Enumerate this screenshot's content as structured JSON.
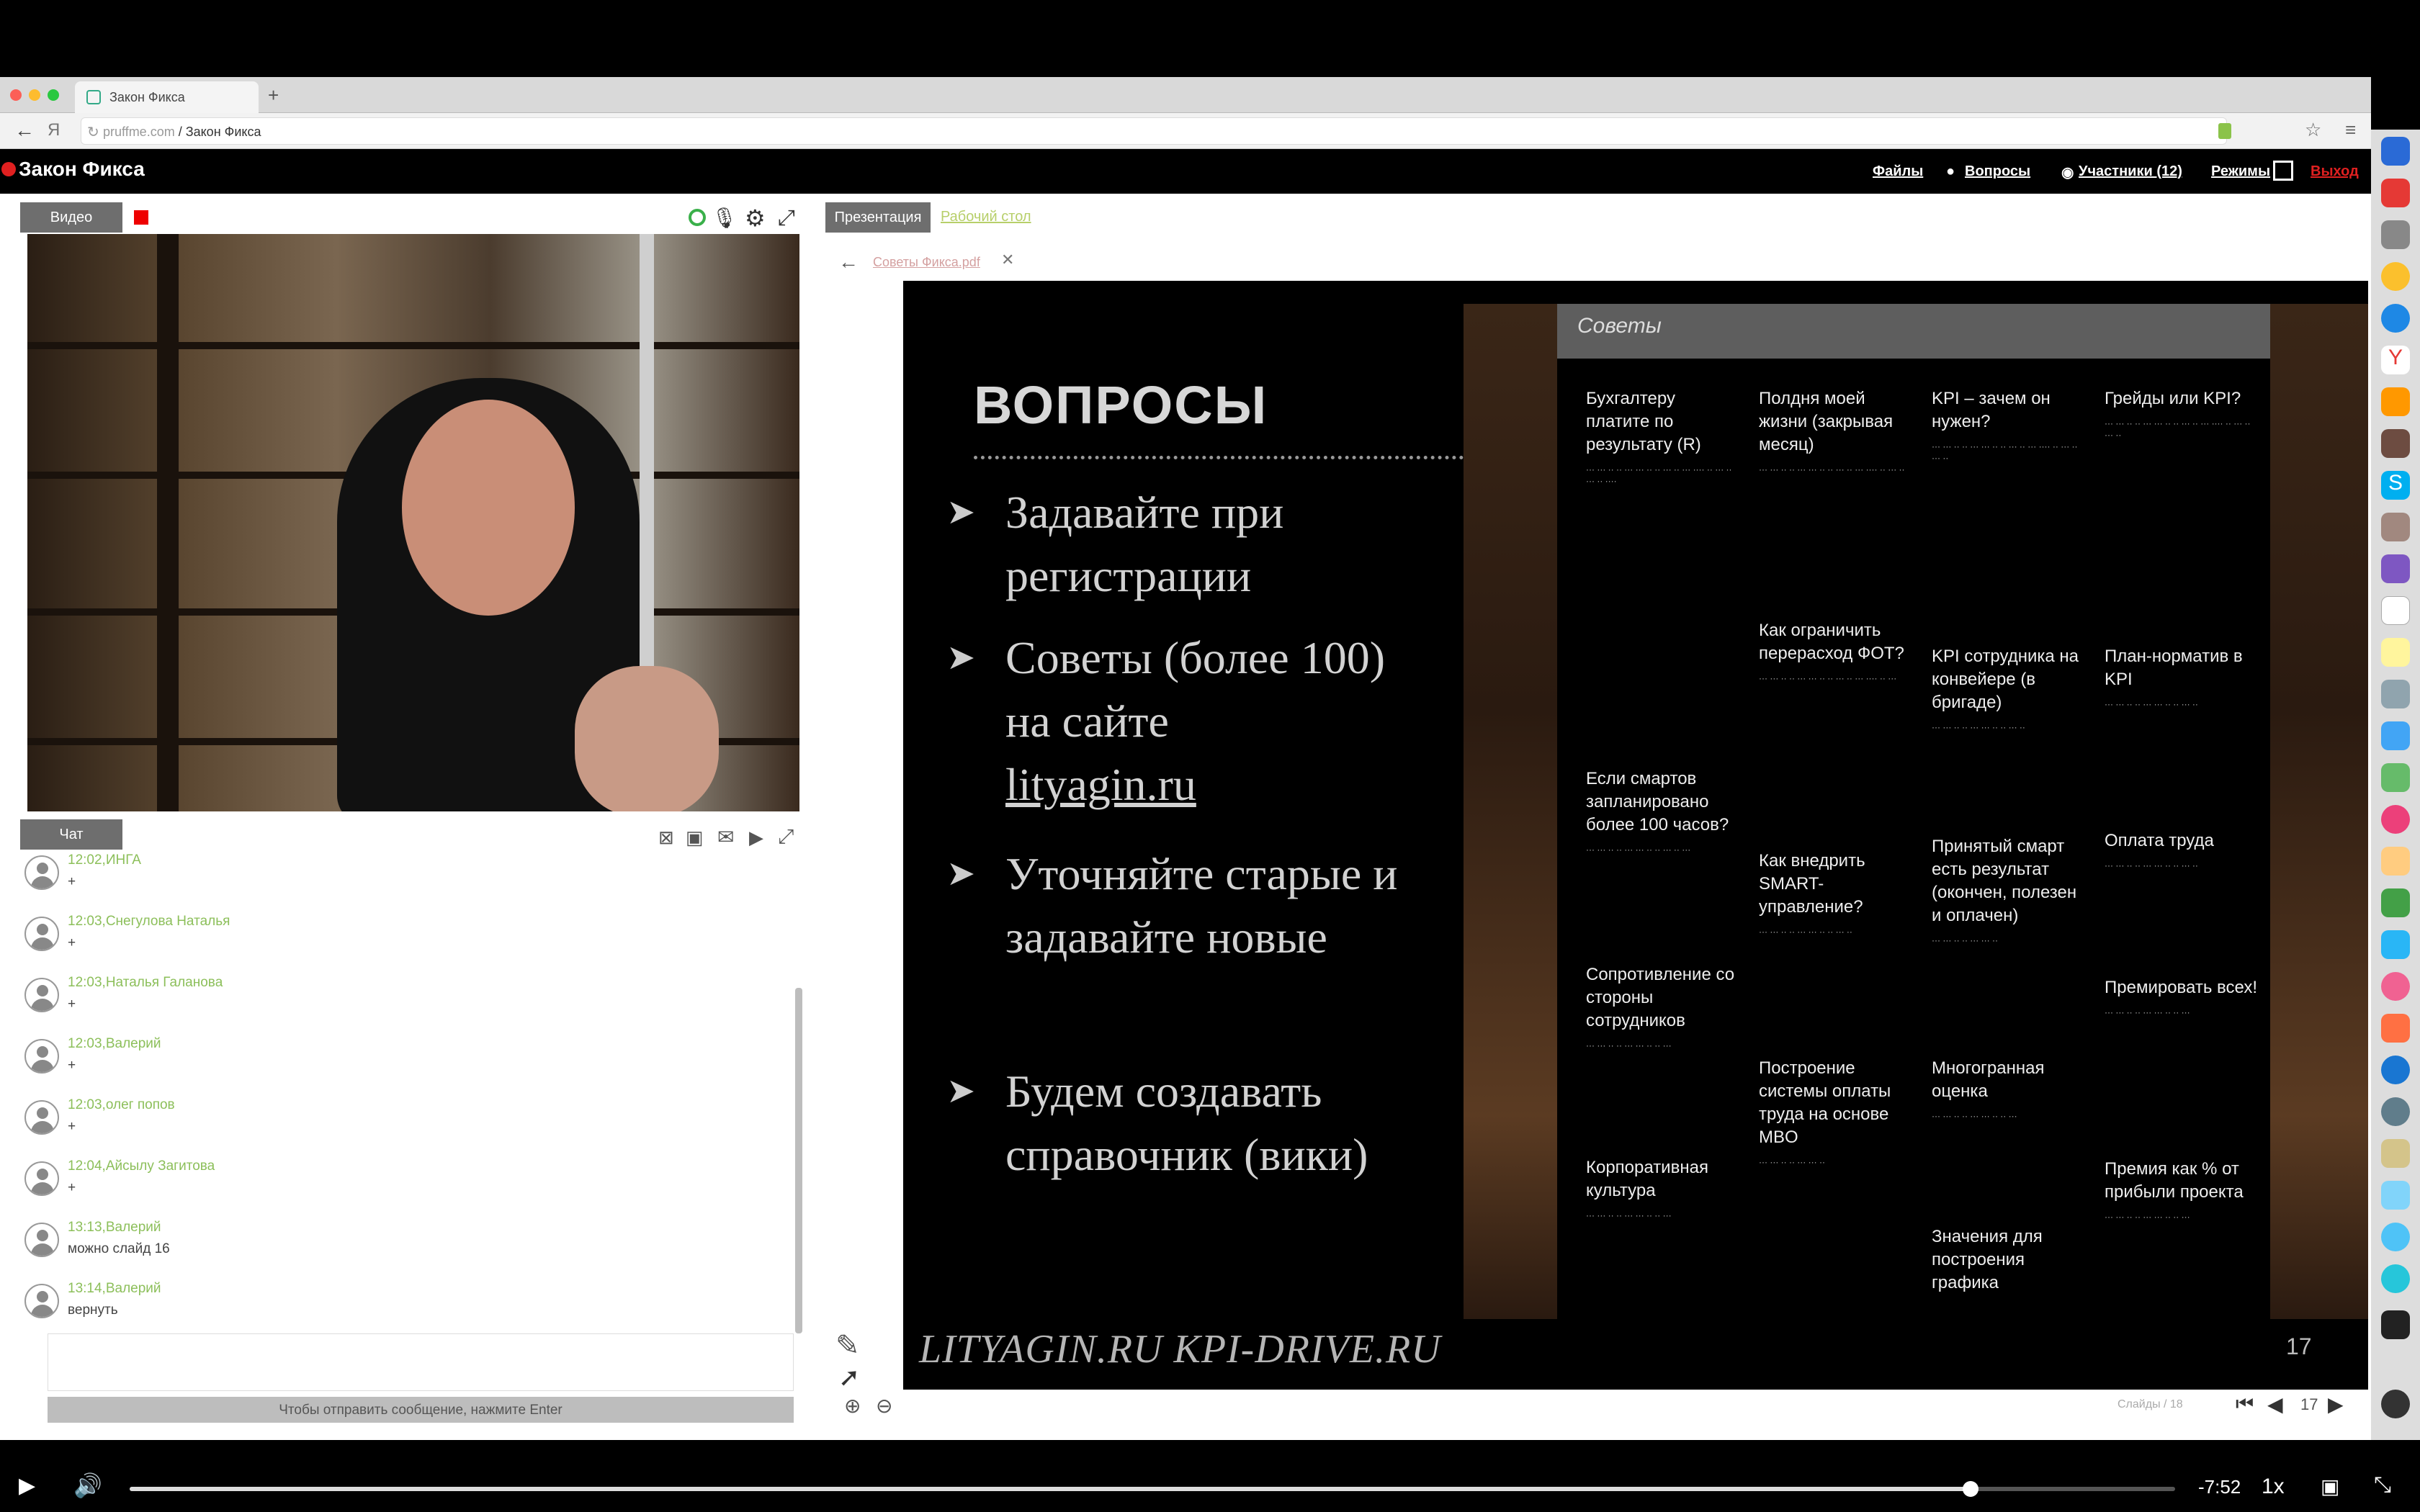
{
  "browser": {
    "tab_title": "Закон Фикса",
    "address_host": "pruffme.com",
    "address_path": "/ Закон Фикса"
  },
  "app": {
    "title": "Закон Фикса",
    "nav": [
      "Файлы",
      "Вопросы",
      "Участники (12)",
      "Режимы",
      "Выход"
    ]
  },
  "video_panel": {
    "tab_label": "Видео"
  },
  "chat": {
    "tab_label": "Чат",
    "messages": [
      {
        "time": "12:02,",
        "author": "ИНГА",
        "text": "+"
      },
      {
        "time": "12:03,",
        "author": "Снегулова Наталья",
        "text": "+"
      },
      {
        "time": "12:03,",
        "author": "Наталья Галанова",
        "text": "+"
      },
      {
        "time": "12:03,",
        "author": "Валерий",
        "text": "+"
      },
      {
        "time": "12:03,",
        "author": "олег попов",
        "text": "+"
      },
      {
        "time": "12:04,",
        "author": "Айсылу Загитова",
        "text": "+"
      },
      {
        "time": "13:13,",
        "author": "Валерий",
        "text": "можно слайд 16"
      },
      {
        "time": "13:14,",
        "author": "Валерий",
        "text": "вернуть"
      }
    ],
    "send_hint": "Чтобы отправить сообщение, нажмите Enter"
  },
  "presentation": {
    "tab_presentation": "Презентация",
    "tab_desktop": "Рабочий стол",
    "file_name": "Советы Фикса.pdf",
    "slide": {
      "heading": "ВОПРОСЫ",
      "bullets": [
        "Задавайте при регистрации",
        "Советы (более 100) на сайте",
        "lityagin.ru",
        "Уточняйте старые и задавайте новые",
        "Будем создавать справочник (вики)"
      ],
      "footer": "LITYAGIN.RU  KPI-DRIVE.RU",
      "page_number": "17",
      "panel_title": "Советы",
      "tips": [
        "Бухгалтеру платите по результату (R)",
        "Полдня моей жизни (закрывая месяц)",
        "KPI – зачем он нужен?",
        "Грейды или KPI?",
        "Как ограничить перерасход ФОТ?",
        "KPI сотрудника на конвейере (в бригаде)",
        "План-норматив в KPI",
        "Если смартов запланировано более 100 часов?",
        "Как внедрить SMART-управление?",
        "Принятый смарт есть результат (окончен, полезен и оплачен)",
        "Оплата труда",
        "Сопротивление со стороны сотрудников",
        "Премировать всех!",
        "Построение системы оплаты труда на основе MBO",
        "Многогранная оценка",
        "Корпоративная культура",
        "Премия как % от прибыли проекта",
        "Значения для построения графика"
      ]
    },
    "pager": {
      "slides_label": "Слайды",
      "total": "18",
      "current": "17"
    }
  },
  "player": {
    "time_remaining": "-7:52",
    "speed": "1x",
    "progress": 0.9
  }
}
